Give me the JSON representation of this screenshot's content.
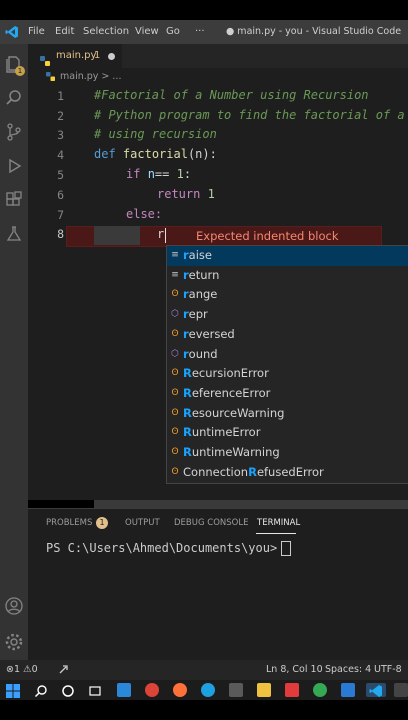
{
  "menu": {
    "file": "File",
    "edit": "Edit",
    "selection": "Selection",
    "view": "View",
    "go": "Go",
    "more": "···"
  },
  "window_title": "● main.py - you - Visual Studio Code",
  "tab": {
    "label": "main.py",
    "count": "1"
  },
  "breadcrumb": "main.py > ...",
  "code": {
    "line_numbers": [
      "1",
      "2",
      "3",
      "4",
      "5",
      "6",
      "7",
      "8"
    ],
    "l1": "#Factorial of a Number using Recursion",
    "l2": "# Python program to find the factorial of a",
    "l3": "# using recursion",
    "l4_def": "def",
    "l4_name": "factorial",
    "l4_rest": "(n):",
    "l5_if": "if",
    "l5_var": "n",
    "l5_op": "== ",
    "l5_num": "1",
    "l5_end": ":",
    "l6_ret": "return",
    "l6_num": "1",
    "l7": "else:",
    "l8": "r"
  },
  "error_message": "Expected indented block",
  "suggestions": [
    {
      "icon": "keyword-icon",
      "match": "r",
      "rest": "aise"
    },
    {
      "icon": "keyword-icon",
      "match": "r",
      "rest": "eturn"
    },
    {
      "icon": "class-icon",
      "match": "r",
      "rest": "ange"
    },
    {
      "icon": "module-icon",
      "match": "r",
      "rest": "epr"
    },
    {
      "icon": "class-icon",
      "match": "r",
      "rest": "eversed"
    },
    {
      "icon": "module-icon",
      "match": "r",
      "rest": "ound"
    },
    {
      "icon": "class-icon",
      "match": "R",
      "rest": "ecursionError"
    },
    {
      "icon": "class-icon",
      "match": "R",
      "rest": "eferenceError"
    },
    {
      "icon": "class-icon",
      "match": "R",
      "rest": "esourceWarning"
    },
    {
      "icon": "class-icon",
      "match": "R",
      "rest": "untimeError"
    },
    {
      "icon": "class-icon",
      "match": "R",
      "rest": "untimeWarning"
    },
    {
      "icon": "class-icon",
      "pre": "Connection",
      "match": "R",
      "rest": "efusedError"
    }
  ],
  "panel": {
    "problems": "PROBLEMS",
    "problems_count": "1",
    "output": "OUTPUT",
    "debug": "DEBUG CONSOLE",
    "terminal": "TERMINAL",
    "prompt": "PS C:\\Users\\Ahmed\\Documents\\you>"
  },
  "status": {
    "errors": "1",
    "warnings": "0",
    "position": "Ln 8, Col 10",
    "spaces": "Spaces: 4",
    "encoding": "UTF-8"
  },
  "colors": {
    "accent": "#18a3ff",
    "error": "#f48771",
    "modified": "#e2c08d"
  }
}
